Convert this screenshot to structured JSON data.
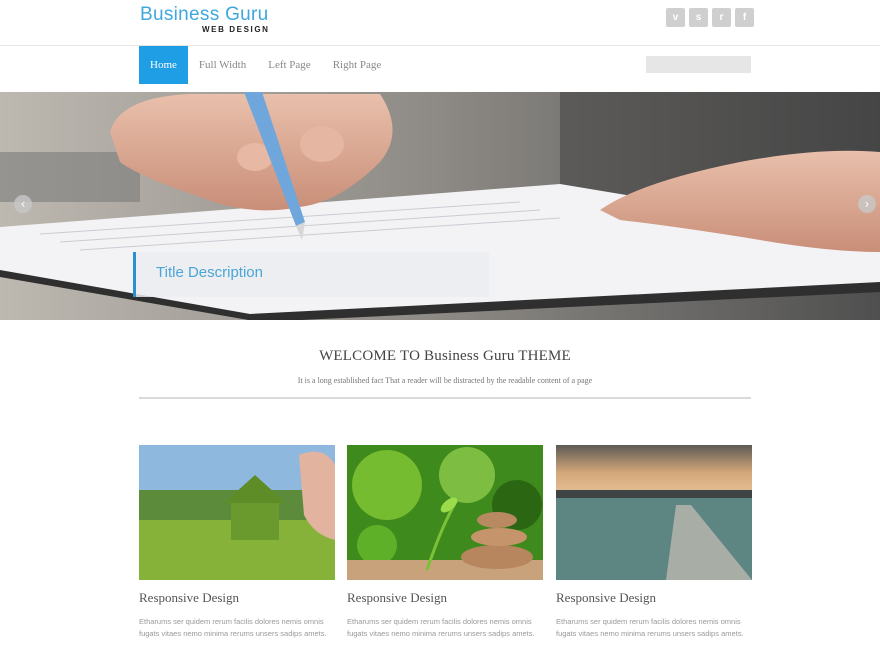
{
  "header": {
    "logo_title": "Business Guru",
    "logo_subtitle": "WEB DESIGN",
    "social": [
      {
        "icon": "vimeo-icon",
        "glyph": "v"
      },
      {
        "icon": "skype-icon",
        "glyph": "s"
      },
      {
        "icon": "rss-icon",
        "glyph": "r"
      },
      {
        "icon": "facebook-icon",
        "glyph": "f"
      }
    ]
  },
  "nav": {
    "items": [
      {
        "label": "Home",
        "active": true
      },
      {
        "label": "Full Width",
        "active": false
      },
      {
        "label": "Left Page",
        "active": false
      },
      {
        "label": "Right Page",
        "active": false
      }
    ],
    "search_placeholder": ""
  },
  "slider": {
    "caption": "Title Description",
    "prev_icon": "chevron-left-icon",
    "next_icon": "chevron-right-icon"
  },
  "welcome": {
    "title": "WELCOME TO Business Guru THEME",
    "text": "It is a long established fact That a reader will be distracted by the readable content of a page"
  },
  "features": [
    {
      "title": "Responsive Design",
      "text": "Etharums ser quidem rerum facilis dolores nemis omnis fugats vitaes nemo minima rerums unsers sadips amets."
    },
    {
      "title": "Responsive Design",
      "text": "Etharums ser quidem rerum facilis dolores nemis omnis fugats vitaes nemo minima rerums unsers sadips amets."
    },
    {
      "title": "Responsive Design",
      "text": "Etharums ser quidem rerum facilis dolores nemis omnis fugats vitaes nemo minima rerums unsers sadips amets."
    }
  ],
  "colors": {
    "accent": "#1f9ee6",
    "logo": "#3ea7dd"
  }
}
